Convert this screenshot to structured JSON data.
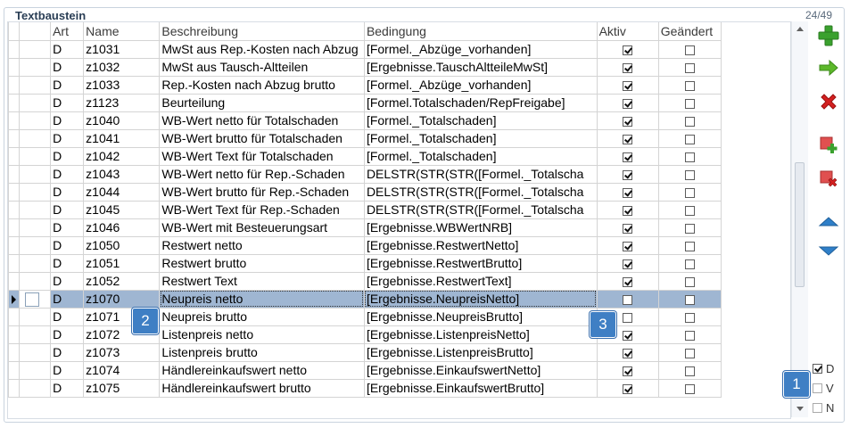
{
  "group": {
    "title": "Textbaustein",
    "count": "24/49"
  },
  "columns": {
    "art": "Art",
    "name": "Name",
    "beschreibung": "Beschreibung",
    "bedingung": "Bedingung",
    "aktiv": "Aktiv",
    "geaendert": "Geändert"
  },
  "rows": [
    {
      "art": "D",
      "name": "z1031",
      "beschreibung": "MwSt aus Rep.-Kosten nach Abzug",
      "bedingung": "[Formel._Abzüge_vorhanden]",
      "aktiv": true,
      "geaendert": false
    },
    {
      "art": "D",
      "name": "z1032",
      "beschreibung": "MwSt aus Tausch-Altteilen",
      "bedingung": "[Ergebnisse.TauschAltteileMwSt]",
      "aktiv": true,
      "geaendert": false
    },
    {
      "art": "D",
      "name": "z1033",
      "beschreibung": "Rep.-Kosten nach Abzug brutto",
      "bedingung": "[Formel._Abzüge_vorhanden]",
      "aktiv": true,
      "geaendert": false
    },
    {
      "art": "D",
      "name": "z1123",
      "beschreibung": "Beurteilung",
      "bedingung": "[Formel.Totalschaden/RepFreigabe]",
      "aktiv": true,
      "geaendert": false
    },
    {
      "art": "D",
      "name": "z1040",
      "beschreibung": "WB-Wert netto für Totalschaden",
      "bedingung": "[Formel._Totalschaden]",
      "aktiv": true,
      "geaendert": false
    },
    {
      "art": "D",
      "name": "z1041",
      "beschreibung": "WB-Wert brutto für Totalschaden",
      "bedingung": "[Formel._Totalschaden]",
      "aktiv": true,
      "geaendert": false
    },
    {
      "art": "D",
      "name": "z1042",
      "beschreibung": "WB-Wert Text für Totalschaden",
      "bedingung": "[Formel._Totalschaden]",
      "aktiv": true,
      "geaendert": false
    },
    {
      "art": "D",
      "name": "z1043",
      "beschreibung": "WB-Wert netto für Rep.-Schaden",
      "bedingung": "DELSTR(STR(STR([Formel._Totalscha",
      "aktiv": true,
      "geaendert": false
    },
    {
      "art": "D",
      "name": "z1044",
      "beschreibung": "WB-Wert brutto für Rep.-Schaden",
      "bedingung": "DELSTR(STR(STR([Formel._Totalscha",
      "aktiv": true,
      "geaendert": false
    },
    {
      "art": "D",
      "name": "z1045",
      "beschreibung": "WB-Wert Text für Rep.-Schaden",
      "bedingung": "DELSTR(STR(STR([Formel._Totalscha",
      "aktiv": true,
      "geaendert": false
    },
    {
      "art": "D",
      "name": "z1046",
      "beschreibung": "WB-Wert mit Besteuerungsart",
      "bedingung": "[Ergebnisse.WBWertNRB]",
      "aktiv": true,
      "geaendert": false
    },
    {
      "art": "D",
      "name": "z1050",
      "beschreibung": "Restwert netto",
      "bedingung": "[Ergebnisse.RestwertNetto]",
      "aktiv": true,
      "geaendert": false
    },
    {
      "art": "D",
      "name": "z1051",
      "beschreibung": "Restwert brutto",
      "bedingung": "[Ergebnisse.RestwertBrutto]",
      "aktiv": true,
      "geaendert": false
    },
    {
      "art": "D",
      "name": "z1052",
      "beschreibung": "Restwert Text",
      "bedingung": "[Ergebnisse.RestwertText]",
      "aktiv": true,
      "geaendert": false
    },
    {
      "art": "D",
      "name": "z1070",
      "beschreibung": "Neupreis netto",
      "bedingung": "[Ergebnisse.NeupreisNetto]",
      "aktiv": false,
      "geaendert": false,
      "selected": true
    },
    {
      "art": "D",
      "name": "z1071",
      "beschreibung": "Neupreis brutto",
      "bedingung": "[Ergebnisse.NeupreisBrutto]",
      "aktiv": false,
      "geaendert": false
    },
    {
      "art": "D",
      "name": "z1072",
      "beschreibung": "Listenpreis netto",
      "bedingung": "[Ergebnisse.ListenpreisNetto]",
      "aktiv": true,
      "geaendert": false
    },
    {
      "art": "D",
      "name": "z1073",
      "beschreibung": "Listenpreis brutto",
      "bedingung": "[Ergebnisse.ListenpreisBrutto]",
      "aktiv": true,
      "geaendert": false
    },
    {
      "art": "D",
      "name": "z1074",
      "beschreibung": "Händlereinkaufswert netto",
      "bedingung": "[Ergebnisse.EinkaufswertNetto]",
      "aktiv": true,
      "geaendert": false
    },
    {
      "art": "D",
      "name": "z1075",
      "beschreibung": "Händlereinkaufswert brutto",
      "bedingung": "[Ergebnisse.EinkaufswertBrutto]",
      "aktiv": true,
      "geaendert": false
    }
  ],
  "side_buttons": [
    {
      "icon": "plus-icon",
      "color": "#3aa12e"
    },
    {
      "icon": "arrow-right-icon",
      "color": "#5cb82a"
    },
    {
      "icon": "delete-x-icon",
      "color": "#d42020"
    },
    {
      "icon": "add-row-icon",
      "color": "#e05050"
    },
    {
      "icon": "remove-row-icon",
      "color": "#e05050"
    },
    {
      "icon": "move-up-icon",
      "color": "#2f7fc8"
    },
    {
      "icon": "move-down-icon",
      "color": "#2f7fc8"
    }
  ],
  "filters": [
    {
      "label": "D",
      "checked": true
    },
    {
      "label": "V",
      "checked": false
    },
    {
      "label": "N",
      "checked": false
    }
  ],
  "badges": [
    "1",
    "2",
    "3"
  ],
  "colors": {
    "selection": "#9fb6d2",
    "badge": "#3f7fc4",
    "frame": "#c9d3de"
  }
}
